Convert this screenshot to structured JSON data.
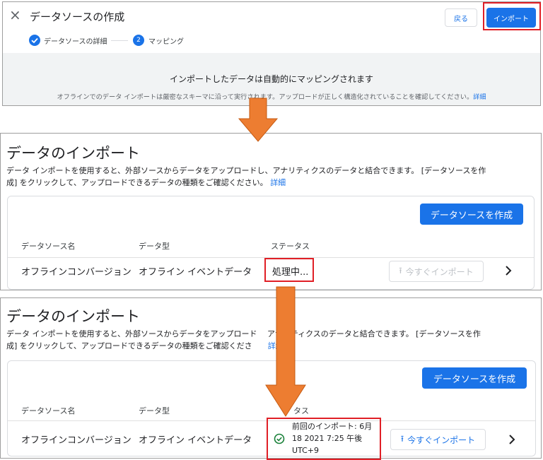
{
  "top_panel": {
    "close_icon": "×",
    "title": "データソースの作成",
    "back_label": "戻る",
    "import_label": "インポート",
    "steps": [
      {
        "label": "データソースの詳細",
        "state": "done"
      },
      {
        "number": "2",
        "label": "マッピング",
        "state": "active"
      }
    ],
    "info_heading": "インポートしたデータは自動的にマッピングされます",
    "info_text": "オフラインでのデータ インポートは厳密なスキーマに沿って実行されます。アップロードが正しく構造化されていることを確認してください。",
    "info_link": "詳細"
  },
  "middle_panel": {
    "title": "データのインポート",
    "desc_line1": "データ インポートを使用すると、外部ソースからデータをアップロードし、アナリティクスのデータと結合できます。 [データソースを作",
    "desc_line2": "成] をクリックして、アップロードできるデータの種類をご確認ください。",
    "desc_link": "詳細",
    "create_button": "データソースを作成",
    "columns": [
      "データソース名",
      "データ型",
      "ステータス"
    ],
    "row": {
      "name": "オフラインコンバージョン",
      "type": "オフライン イベントデータ",
      "status": "処理中...",
      "import_now": "今すぐインポート"
    }
  },
  "bottom_panel": {
    "title": "データのインポート",
    "desc_line1": "データ インポートを使用すると、外部ソースからデータをアップロード　 アナリティクスのデータと結合できます。 [データソースを作",
    "desc_line2": "成] をクリックして、アップロードできるデータの種類をご確認くださ",
    "desc_link": "詳細",
    "create_button": "データソースを作成",
    "columns": [
      "データソース名",
      "データ型",
      "タス"
    ],
    "row": {
      "name": "オフラインコンバージョン",
      "type": "オフライン イベントデータ",
      "status_line1": "前回のインポート: 6月",
      "status_line2": "18 2021 7:25 午後",
      "status_line3": "UTC+9",
      "import_now": "今すぐインポート"
    }
  },
  "colors": {
    "accent": "#1a73e8",
    "annotation_red": "#e01f26",
    "arrow_orange": "#ed7d31",
    "success_green": "#188038"
  },
  "icons": {
    "close": "close-icon",
    "check": "check-circle-icon",
    "upload": "upload-icon",
    "chevron": "chevron-right-icon"
  }
}
